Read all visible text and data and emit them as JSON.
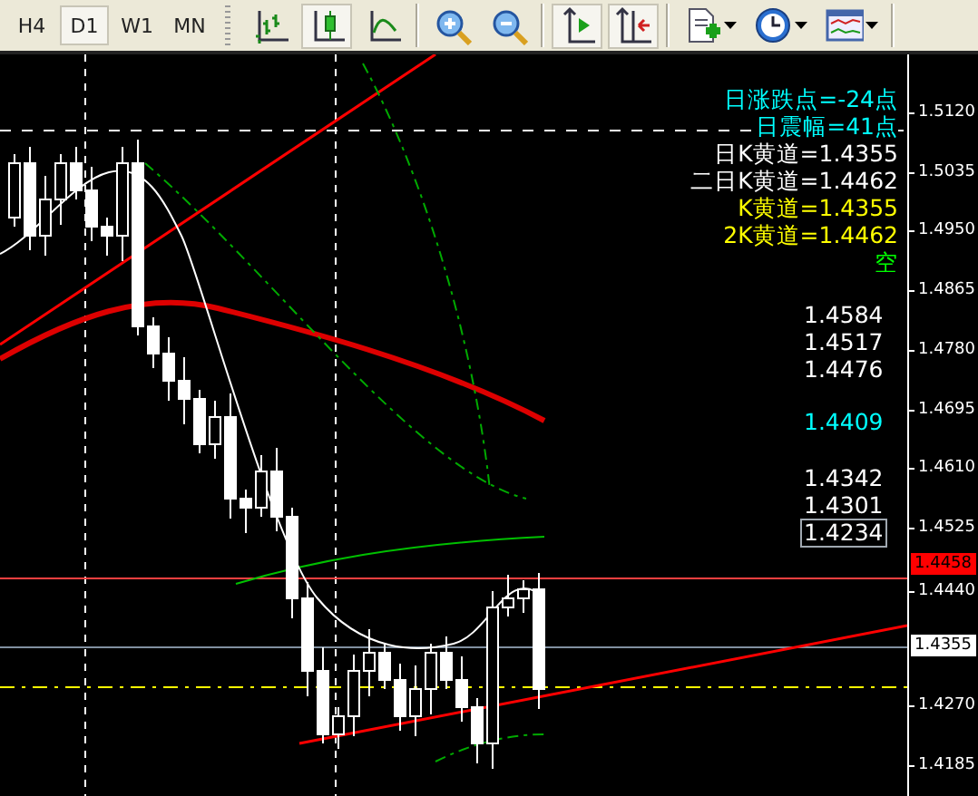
{
  "toolbar": {
    "timeframes": [
      {
        "label": "H4",
        "selected": false
      },
      {
        "label": "D1",
        "selected": true
      },
      {
        "label": "W1",
        "selected": false
      },
      {
        "label": "MN",
        "selected": false
      }
    ],
    "tools": [
      {
        "kind": "bars",
        "selected": false
      },
      {
        "kind": "candles",
        "selected": true
      },
      {
        "kind": "line",
        "selected": false
      },
      {
        "kind": "zoom-in",
        "selected": false
      },
      {
        "kind": "zoom-out",
        "selected": false
      },
      {
        "kind": "autoscroll",
        "selected": true
      },
      {
        "kind": "shift",
        "selected": true
      },
      {
        "kind": "new-chart",
        "selected": false
      },
      {
        "kind": "periods",
        "selected": false
      },
      {
        "kind": "templates",
        "selected": false
      }
    ]
  },
  "info_lines": [
    {
      "text": "日涨跌点=-24点",
      "color": "#00ffff"
    },
    {
      "text": "日震幅=41点",
      "color": "#00ffff"
    },
    {
      "text": "日K黄道=1.4355",
      "color": "#ffffff"
    },
    {
      "text": "二日K黄道=1.4462",
      "color": "#ffffff"
    },
    {
      "text": "K黄道=1.4355",
      "color": "#ffff00"
    },
    {
      "text": "2K黄道=1.4462",
      "color": "#ffff00"
    },
    {
      "text": "空",
      "color": "#00ff00"
    }
  ],
  "levels": [
    {
      "text": "1.4584",
      "color": "#ffffff",
      "boxed": false
    },
    {
      "text": "1.4517",
      "color": "#ffffff",
      "boxed": false
    },
    {
      "text": "1.4476",
      "color": "#ffffff",
      "boxed": false
    },
    {
      "text": "1.4409",
      "color": "#00ffff",
      "boxed": false
    },
    {
      "text": "1.4342",
      "color": "#ffffff",
      "boxed": false
    },
    {
      "text": "1.4301",
      "color": "#ffffff",
      "boxed": false
    },
    {
      "text": "1.4234",
      "color": "#ffffff",
      "boxed": true
    }
  ],
  "price_axis": [
    "1.5120",
    "1.5035",
    "1.4950",
    "1.4865",
    "1.4780",
    "1.4695",
    "1.4610",
    "1.4525",
    "1.4440",
    "1.4270",
    "1.4185"
  ],
  "markers": [
    {
      "text": "1.4458",
      "color": "#ff0000"
    },
    {
      "text": "1.4355",
      "color": "#ffffff"
    }
  ]
}
